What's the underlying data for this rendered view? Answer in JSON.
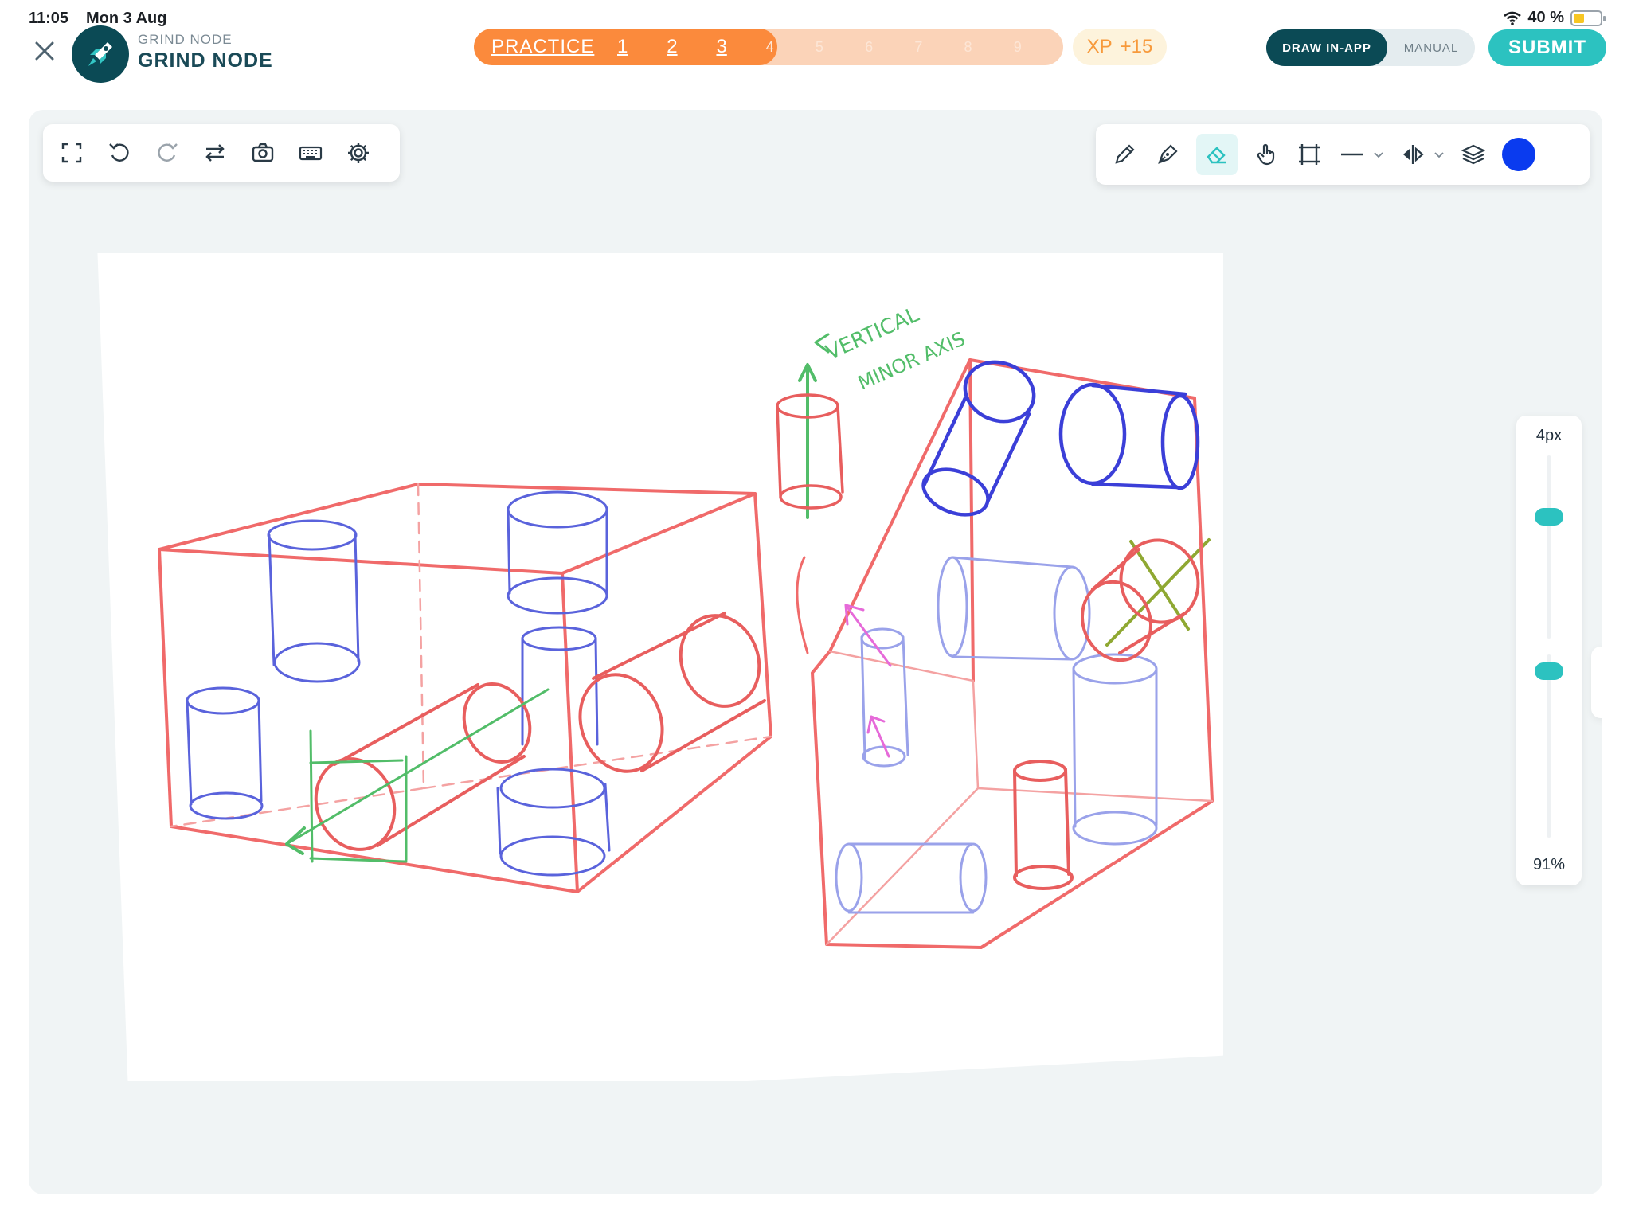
{
  "status": {
    "time": "11:05",
    "date": "Mon 3 Aug",
    "battery_text": "40 %",
    "battery_level": 0.4
  },
  "header": {
    "brand_small": "GRIND NODE",
    "brand_big": "GRIND NODE",
    "progress": {
      "label": "PRACTICE",
      "completed": 3,
      "total": 9,
      "steps": [
        "1",
        "2",
        "3",
        "4",
        "5",
        "6",
        "7",
        "8",
        "9"
      ]
    },
    "xp": {
      "label": "XP",
      "value": "+15"
    },
    "mode": {
      "active": "DRAW IN-APP",
      "inactive": "MANUAL"
    },
    "submit_label": "SUBMIT"
  },
  "toolbar_left": {
    "icons": [
      "fullscreen-icon",
      "undo-icon",
      "redo-icon",
      "swap-icon",
      "camera-icon",
      "keyboard-icon",
      "gear-icon"
    ]
  },
  "toolbar_right": {
    "icons": [
      "pencil-icon",
      "pen-icon",
      "eraser-icon",
      "hand-icon",
      "crop-icon",
      "line-icon",
      "mirror-icon",
      "layers-icon"
    ],
    "active_tool": "eraser-icon",
    "current_color": "#0a3bef"
  },
  "brush": {
    "size_label": "4px",
    "opacity_label": "91%",
    "size_value": 4,
    "opacity_value": 0.91
  },
  "annotation": {
    "line1": "VERTICAL",
    "line2": "MINOR AXIS"
  },
  "colors": {
    "accent": "#2cc2c0",
    "brand_dark": "#0b4a55",
    "progress": "#fb8a3c",
    "stroke_red": "#f06a6a",
    "stroke_blue": "#4d56d9",
    "stroke_green": "#52bd69"
  }
}
